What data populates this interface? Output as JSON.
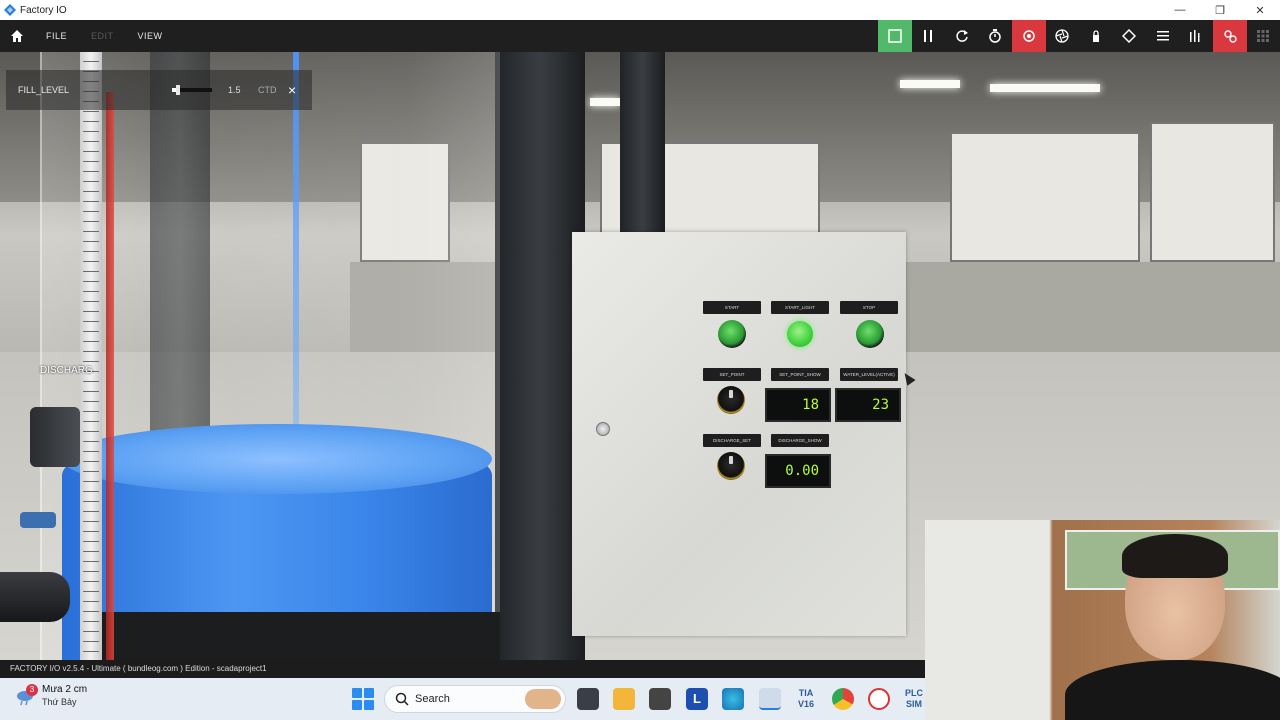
{
  "window": {
    "title": "Factory IO",
    "min_icon": "minimize-icon",
    "restore_icon": "restore-icon",
    "close_icon": "close-icon",
    "close_glyph": "✕",
    "restore_glyph": "❐",
    "min_glyph": "—"
  },
  "toolbar": {
    "menu": [
      {
        "label": "FILE",
        "enabled": true
      },
      {
        "label": "EDIT",
        "enabled": false
      },
      {
        "label": "VIEW",
        "enabled": true
      }
    ],
    "tools": [
      {
        "icon": "stop-square-icon",
        "state": "active-green"
      },
      {
        "icon": "pause-icon"
      },
      {
        "icon": "reset-icon"
      },
      {
        "icon": "timer-icon"
      },
      {
        "icon": "camera-fly-icon",
        "state": "active-red"
      },
      {
        "icon": "aperture-icon"
      },
      {
        "icon": "lock-icon"
      },
      {
        "icon": "diamond-icon"
      },
      {
        "icon": "list-icon"
      },
      {
        "icon": "bars-icon"
      },
      {
        "icon": "drivers-icon",
        "state": "active-red"
      },
      {
        "icon": "grid-icon"
      }
    ]
  },
  "overlay": {
    "tag": "FILL_LEVEL",
    "value": "1.5",
    "slider_fraction": 0.15,
    "extra": "CTD"
  },
  "scene": {
    "discharge_label": "DISCHARG"
  },
  "panel": {
    "labels": {
      "start": "START",
      "start_light": "START_LIGHT",
      "stop": "STOP",
      "set_point": "SET_POINT",
      "set_point_show": "SET_POINT_SHOW",
      "water_level": "WATER_LEVEL(ACTIVE)",
      "discharge_set": "DISCHARGE_SET",
      "discharge_show": "DISCHARGE_SHOW"
    },
    "displays": {
      "set_point_show": "18",
      "water_level": "23",
      "discharge_show": "0.00"
    }
  },
  "statusbar": {
    "text": "FACTORY I/O v2.5.4 - Ultimate ( bundleog.com ) Edition - scadaproject1"
  },
  "taskbar": {
    "weather_temp": "Mưa 2 cm",
    "weather_day": "Thứ Bảy",
    "weather_badge": "3",
    "search_label": "Search",
    "tia_label": "TIA V16",
    "plc_label": "PLC SIM"
  },
  "colors": {
    "toolbar_bg": "#1f1f1f",
    "active_green": "#52b96a",
    "active_red": "#d8383e",
    "lcd_text": "#b6ff3a",
    "water": "#3a86ea"
  }
}
